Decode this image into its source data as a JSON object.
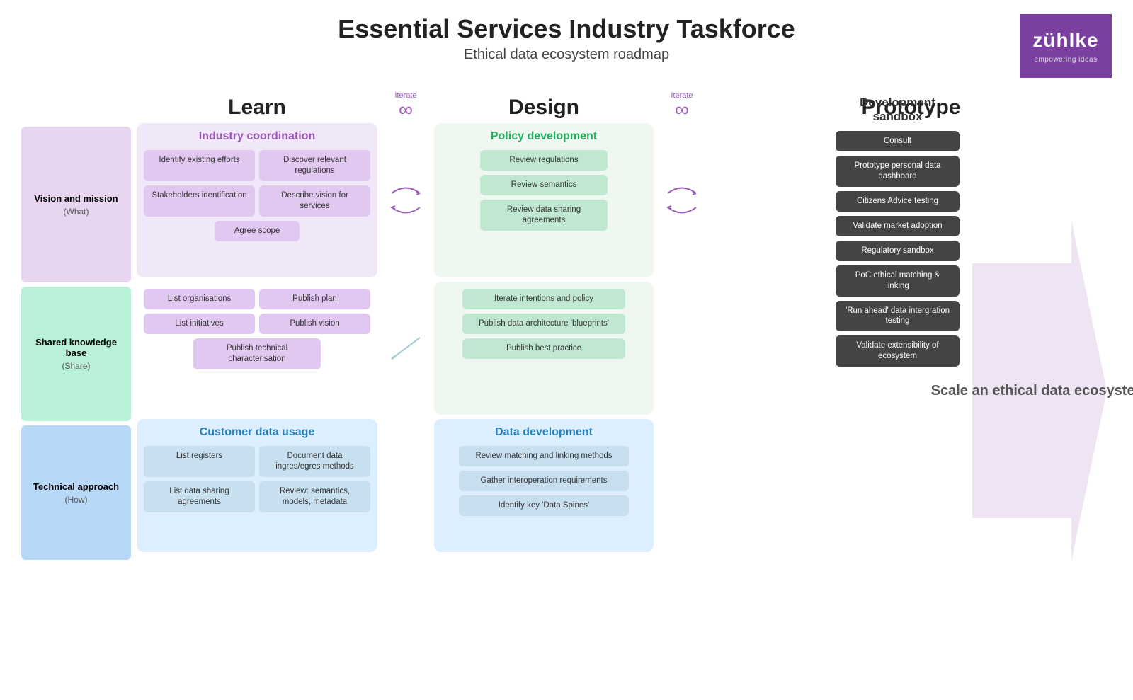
{
  "header": {
    "title": "Essential Services Industry Taskforce",
    "subtitle": "Ethical data ecosystem roadmap"
  },
  "logo": {
    "main": "zühlke",
    "sub": "empowering ideas"
  },
  "phases": {
    "learn": "Learn",
    "iterate1": "Iterate",
    "design": "Design",
    "iterate2": "Iterate",
    "prototype": "Prototype"
  },
  "row_labels": {
    "vision": {
      "title": "Vision and mission",
      "sub": "(What)"
    },
    "shared": {
      "title": "Shared knowledge base",
      "sub": "(Share)"
    },
    "technical": {
      "title": "Technical approach",
      "sub": "(How)"
    }
  },
  "industry_coord": {
    "title": "Industry coordination",
    "cards": [
      {
        "text": "Identify existing efforts"
      },
      {
        "text": "Discover relevant regulations"
      },
      {
        "text": "Stakeholders identification"
      },
      {
        "text": "Describe vision for services"
      },
      {
        "text": "Agree scope"
      }
    ]
  },
  "policy_dev": {
    "title": "Policy development",
    "cards": [
      {
        "text": "Review regulations"
      },
      {
        "text": "Review semantics"
      },
      {
        "text": "Review data sharing agreements"
      }
    ]
  },
  "dev_sandbox": {
    "title": "Development sandbox",
    "cards": [
      {
        "text": "Consult"
      },
      {
        "text": "Prototype personal data dashboard"
      },
      {
        "text": "Citizens Advice testing"
      },
      {
        "text": "Validate market adoption"
      },
      {
        "text": "Regulatory sandbox"
      },
      {
        "text": "PoC ethical matching & linking"
      },
      {
        "text": "'Run ahead' data intergration testing"
      },
      {
        "text": "Validate extensibility of ecosystem"
      }
    ]
  },
  "knowledge_learn": {
    "cards": [
      {
        "text": "List organisations"
      },
      {
        "text": "Publish plan"
      },
      {
        "text": "List initiatives"
      },
      {
        "text": "Publish vision"
      },
      {
        "text": "Publish technical characterisation"
      }
    ]
  },
  "knowledge_design": {
    "cards": [
      {
        "text": "Iterate intentions and policy"
      },
      {
        "text": "Publish data architecture 'blueprints'"
      },
      {
        "text": "Publish best practice"
      }
    ]
  },
  "customer_data": {
    "title": "Customer data usage",
    "cards": [
      {
        "text": "List registers"
      },
      {
        "text": "Document data ingres/egres methods"
      },
      {
        "text": "List data sharing agreements"
      },
      {
        "text": "Review: semantics, models, metadata"
      }
    ]
  },
  "data_dev": {
    "title": "Data development",
    "cards": [
      {
        "text": "Review matching and linking methods"
      },
      {
        "text": "Gather interoperation requirements"
      },
      {
        "text": "Identify key 'Data Spines'"
      }
    ]
  },
  "scale": {
    "text": "Scale an ethical data ecosystem"
  }
}
